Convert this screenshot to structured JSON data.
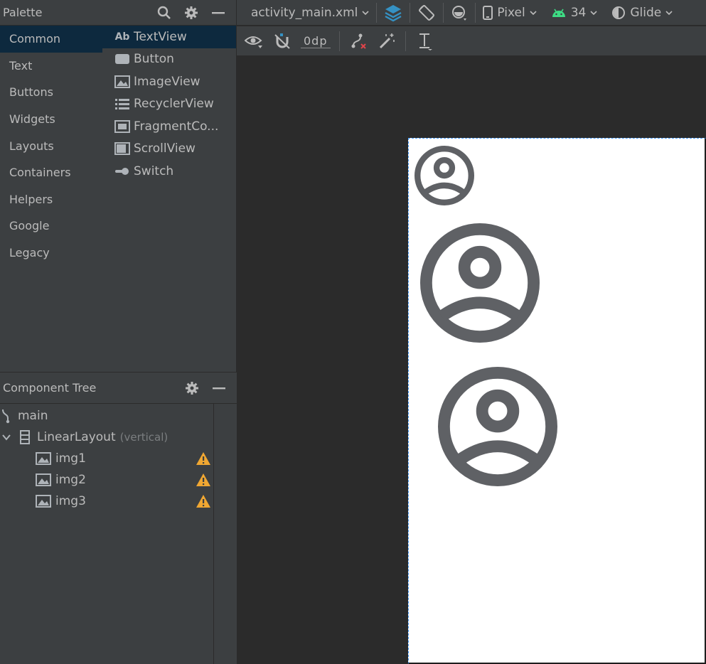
{
  "palette": {
    "title": "Palette",
    "categories": [
      {
        "label": "Common",
        "active": true
      },
      {
        "label": "Text"
      },
      {
        "label": "Buttons"
      },
      {
        "label": "Widgets"
      },
      {
        "label": "Layouts"
      },
      {
        "label": "Containers"
      },
      {
        "label": "Helpers"
      },
      {
        "label": "Google"
      },
      {
        "label": "Legacy"
      }
    ],
    "widgets": [
      {
        "label": "TextView",
        "icon": "Ab",
        "active": true
      },
      {
        "label": "Button",
        "icon": "button-icon"
      },
      {
        "label": "ImageView",
        "icon": "image-icon"
      },
      {
        "label": "RecyclerView",
        "icon": "list-icon"
      },
      {
        "label": "FragmentCo...",
        "icon": "fragment-icon"
      },
      {
        "label": "ScrollView",
        "icon": "scrollview-icon"
      },
      {
        "label": "Switch",
        "icon": "switch-icon"
      }
    ]
  },
  "tree": {
    "title": "Component Tree",
    "root": "main",
    "layout": {
      "label": "LinearLayout",
      "tail": "(vertical)"
    },
    "children": [
      "img1",
      "img2",
      "img3"
    ]
  },
  "toolbar": {
    "file": "activity_main.xml",
    "device": "Pixel",
    "api": "34",
    "theme": "Glide"
  },
  "second_toolbar": {
    "margin": "0dp"
  },
  "colors": {
    "panel": "#3c3f41",
    "selected": "#0d293e",
    "warning": "#f0a732",
    "android_green": "#3ddc84",
    "layer_blue": "#3592c4"
  }
}
